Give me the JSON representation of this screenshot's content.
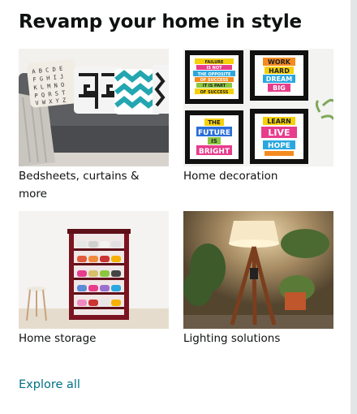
{
  "card": {
    "title": "Revamp your home in style",
    "explore_label": "Explore all"
  },
  "tiles": [
    {
      "label": "Bedsheets, curtains & more",
      "image": "sofa-cushions-image"
    },
    {
      "label": "Home decoration",
      "image": "framed-wall-art-image"
    },
    {
      "label": "Home storage",
      "image": "shoe-rack-image"
    },
    {
      "label": "Lighting solutions",
      "image": "tripod-floor-lamp-image"
    }
  ],
  "posters": {
    "p1": [
      "FAILURE",
      "IS NOT",
      "THE OPPOSITE",
      "OF SUCCESS",
      "IT IS PART",
      "OF SUCCESS"
    ],
    "p2": [
      "WORK",
      "HARD",
      "DREAM",
      "BIG"
    ],
    "p3": [
      "THE",
      "FUTURE",
      "IS",
      "BRIGHT"
    ],
    "p4": [
      "LEARN",
      "LIVE",
      "HOPE"
    ]
  },
  "colors": {
    "link": "#007185",
    "text": "#0f1111",
    "page_bg": "#e3e6e6",
    "card_bg": "#ffffff"
  }
}
